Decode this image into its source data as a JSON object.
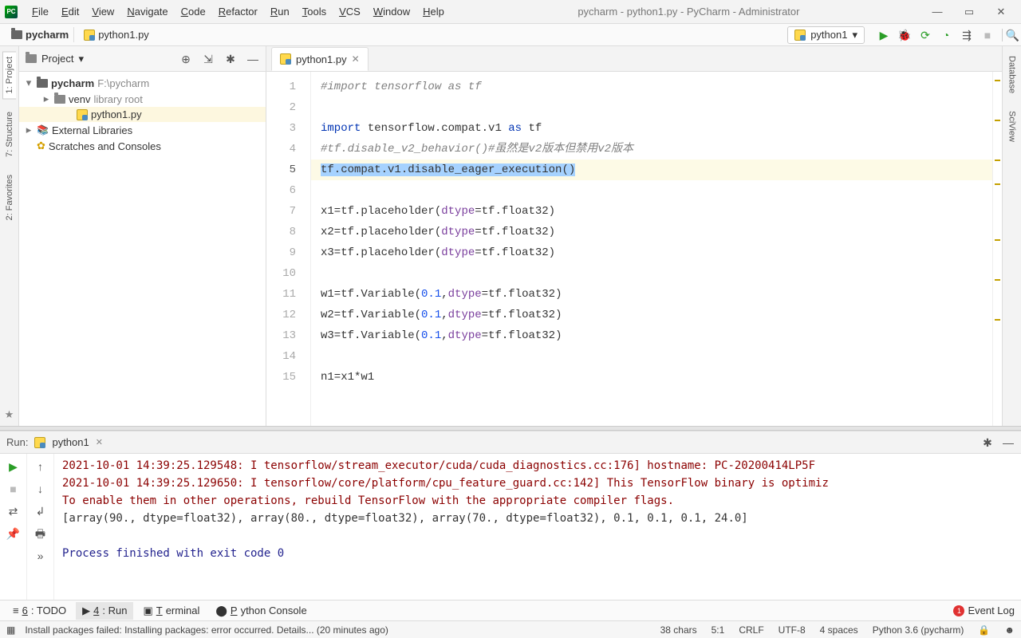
{
  "window": {
    "title": "pycharm - python1.py - PyCharm - Administrator"
  },
  "menu": [
    "File",
    "Edit",
    "View",
    "Navigate",
    "Code",
    "Refactor",
    "Run",
    "Tools",
    "VCS",
    "Window",
    "Help"
  ],
  "breadcrumbs": {
    "project": "pycharm",
    "file": "python1.py"
  },
  "run_config": "python1",
  "left_rails": [
    {
      "label": "1: Project",
      "active": true
    },
    {
      "label": "7: Structure",
      "active": false
    }
  ],
  "right_rails": [
    {
      "label": "Database"
    },
    {
      "label": "SciView"
    }
  ],
  "project_pane": {
    "title": "Project",
    "tree": [
      {
        "name": "pycharm",
        "path": "F:\\pycharm",
        "expanded": true,
        "icon": "folder-dark",
        "bold": true,
        "lvl": 0,
        "tw": "▾"
      },
      {
        "name": "venv",
        "note": "library root",
        "expanded": false,
        "icon": "folder",
        "lvl": 1,
        "tw": "▸"
      },
      {
        "name": "python1.py",
        "icon": "py",
        "selected": true,
        "lvl": 2,
        "tw": ""
      },
      {
        "name": "External Libraries",
        "icon": "libs",
        "lvl": 0,
        "tw": "▸"
      },
      {
        "name": "Scratches and Consoles",
        "icon": "scratch",
        "lvl": 0,
        "tw": ""
      }
    ]
  },
  "tabs": [
    {
      "name": "python1.py",
      "active": true
    }
  ],
  "code": {
    "current_line": 5,
    "lines": [
      {
        "n": 1,
        "segs": [
          {
            "t": "#import tensorflow as tf",
            "c": "tok-cmt"
          }
        ]
      },
      {
        "n": 2,
        "segs": []
      },
      {
        "n": 3,
        "segs": [
          {
            "t": "import ",
            "c": "tok-kw"
          },
          {
            "t": "tensorflow.compat.v1 "
          },
          {
            "t": "as ",
            "c": "tok-kw"
          },
          {
            "t": "tf"
          }
        ]
      },
      {
        "n": 4,
        "segs": [
          {
            "t": "#tf.disable_v2_behavior()#虽然是v2版本但禁用v2版本",
            "c": "tok-cmt"
          }
        ]
      },
      {
        "n": 5,
        "segs": [
          {
            "t": "tf.compat.v1.disable_eager_execution()",
            "c": "sel"
          }
        ]
      },
      {
        "n": 6,
        "segs": []
      },
      {
        "n": 7,
        "segs": [
          {
            "t": "x1=tf.placeholder("
          },
          {
            "t": "dtype",
            "c": "tok-param"
          },
          {
            "t": "=tf.float32)"
          }
        ]
      },
      {
        "n": 8,
        "segs": [
          {
            "t": "x2=tf.placeholder("
          },
          {
            "t": "dtype",
            "c": "tok-param"
          },
          {
            "t": "=tf.float32)"
          }
        ]
      },
      {
        "n": 9,
        "segs": [
          {
            "t": "x3=tf.placeholder("
          },
          {
            "t": "dtype",
            "c": "tok-param"
          },
          {
            "t": "=tf.float32)"
          }
        ]
      },
      {
        "n": 10,
        "segs": []
      },
      {
        "n": 11,
        "segs": [
          {
            "t": "w1=tf.Variable("
          },
          {
            "t": "0.1",
            "c": "tok-num"
          },
          {
            "t": ","
          },
          {
            "t": "dtype",
            "c": "tok-param"
          },
          {
            "t": "=tf.float32)"
          }
        ]
      },
      {
        "n": 12,
        "segs": [
          {
            "t": "w2=tf.Variable("
          },
          {
            "t": "0.1",
            "c": "tok-num"
          },
          {
            "t": ","
          },
          {
            "t": "dtype",
            "c": "tok-param"
          },
          {
            "t": "=tf.float32)"
          }
        ]
      },
      {
        "n": 13,
        "segs": [
          {
            "t": "w3=tf.Variable("
          },
          {
            "t": "0.1",
            "c": "tok-num"
          },
          {
            "t": ","
          },
          {
            "t": "dtype",
            "c": "tok-param"
          },
          {
            "t": "=tf.float32)"
          }
        ]
      },
      {
        "n": 14,
        "segs": []
      },
      {
        "n": 15,
        "segs": [
          {
            "t": "n1=x1*w1"
          }
        ]
      }
    ]
  },
  "run_panel": {
    "title": "Run:",
    "config": "python1",
    "lines": [
      {
        "t": "2021-10-01 14:39:25.129548: I tensorflow/stream_executor/cuda/cuda_diagnostics.cc:176] hostname: PC-20200414LP5F",
        "c": "t-warn"
      },
      {
        "t": "2021-10-01 14:39:25.129650: I tensorflow/core/platform/cpu_feature_guard.cc:142] This TensorFlow binary is optimiz",
        "c": "t-warn"
      },
      {
        "t": "To enable them in other operations, rebuild TensorFlow with the appropriate compiler flags.",
        "c": "t-warn"
      },
      {
        "t": "[array(90., dtype=float32), array(80., dtype=float32), array(70., dtype=float32), 0.1, 0.1, 0.1, 24.0]",
        "c": ""
      },
      {
        "t": "",
        "c": ""
      },
      {
        "t": "Process finished with exit code 0",
        "c": "t-exit"
      }
    ]
  },
  "bottom_tabs": {
    "items": [
      {
        "label": "6: TODO",
        "icon": "≡"
      },
      {
        "label": "4: Run",
        "icon": "▶",
        "active": true
      },
      {
        "label": "Terminal",
        "icon": "▣"
      },
      {
        "label": "Python Console",
        "icon": "⬤"
      }
    ],
    "event_log": "Event Log",
    "event_badge": "1"
  },
  "status": {
    "left": "Install packages failed: Installing packages: error occurred. Details... (20 minutes ago)",
    "chars": "38 chars",
    "pos": "5:1",
    "eol": "CRLF",
    "enc": "UTF-8",
    "indent": "4 spaces",
    "interp": "Python 3.6 (pycharm)"
  }
}
